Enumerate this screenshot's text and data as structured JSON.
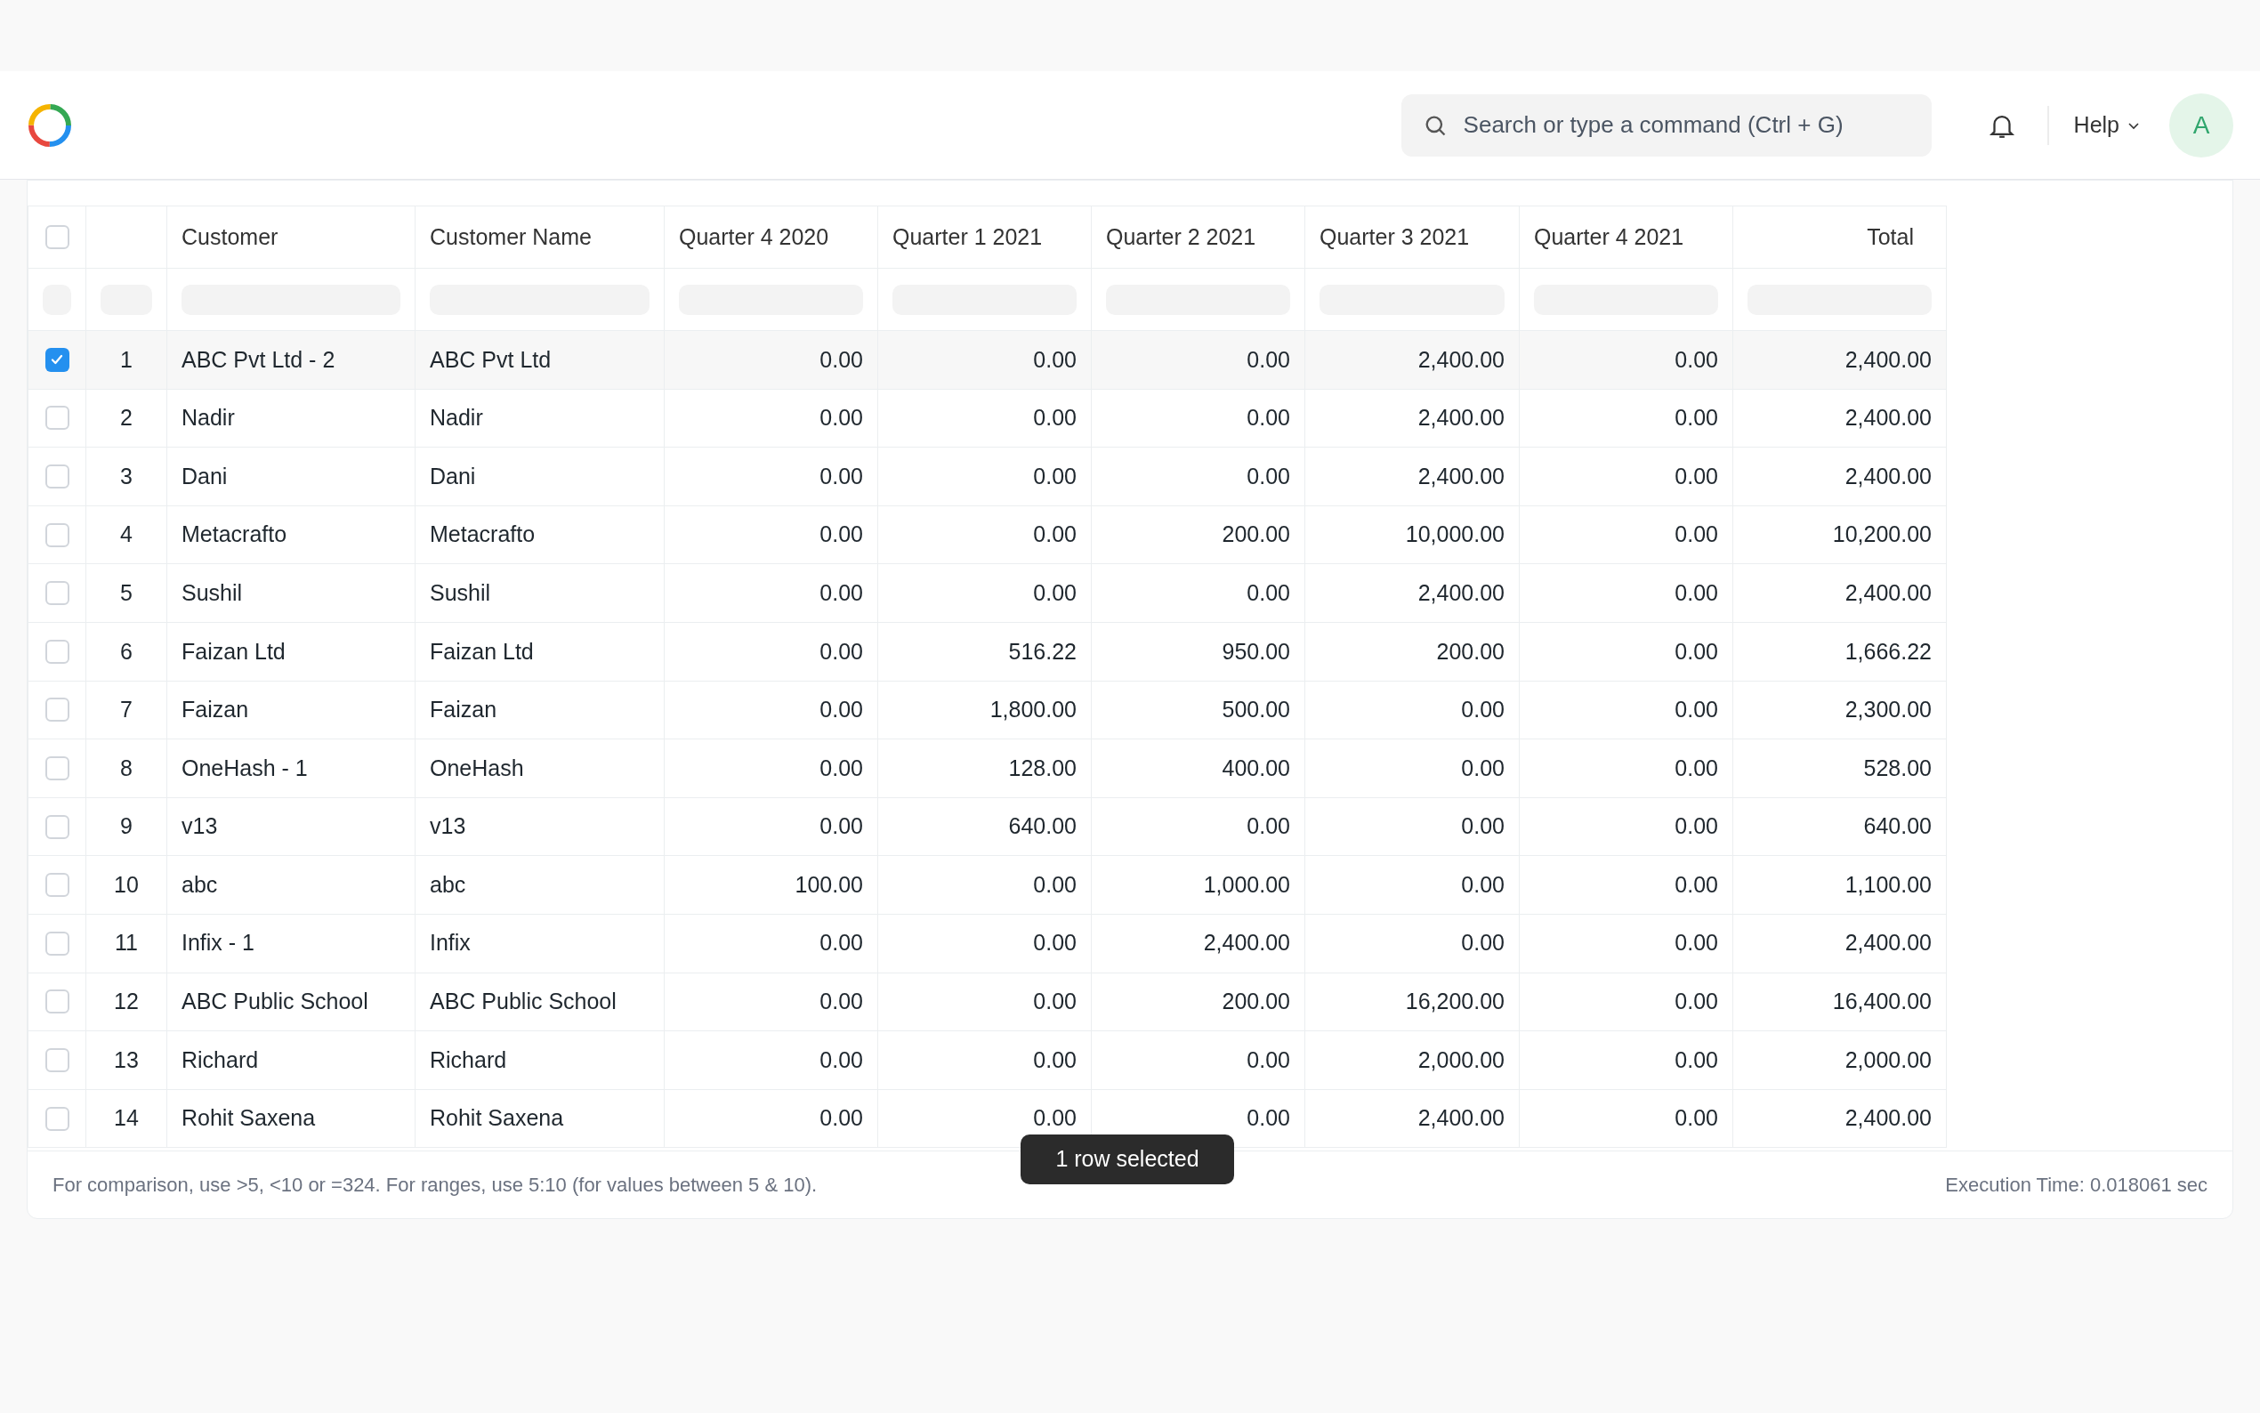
{
  "navbar": {
    "search": {
      "placeholder": "Search or type a command (Ctrl + G)"
    },
    "help": "Help",
    "avatar": "A"
  },
  "table": {
    "select_all": {
      "checked": false
    },
    "columns": [
      "Customer",
      "Customer Name",
      "Quarter 4 2020",
      "Quarter 1 2021",
      "Quarter 2 2021",
      "Quarter 3 2021",
      "Quarter 4 2021",
      "Total"
    ],
    "rows": [
      {
        "selected": true,
        "index": "1",
        "cells": [
          "ABC Pvt Ltd - 2",
          "ABC Pvt Ltd",
          "0.00",
          "0.00",
          "0.00",
          "2,400.00",
          "0.00",
          "2,400.00"
        ]
      },
      {
        "selected": false,
        "index": "2",
        "cells": [
          "Nadir",
          "Nadir",
          "0.00",
          "0.00",
          "0.00",
          "2,400.00",
          "0.00",
          "2,400.00"
        ]
      },
      {
        "selected": false,
        "index": "3",
        "cells": [
          "Dani",
          "Dani",
          "0.00",
          "0.00",
          "0.00",
          "2,400.00",
          "0.00",
          "2,400.00"
        ]
      },
      {
        "selected": false,
        "index": "4",
        "cells": [
          "Metacrafto",
          "Metacrafto",
          "0.00",
          "0.00",
          "200.00",
          "10,000.00",
          "0.00",
          "10,200.00"
        ]
      },
      {
        "selected": false,
        "index": "5",
        "cells": [
          "Sushil",
          "Sushil",
          "0.00",
          "0.00",
          "0.00",
          "2,400.00",
          "0.00",
          "2,400.00"
        ]
      },
      {
        "selected": false,
        "index": "6",
        "cells": [
          "Faizan Ltd",
          "Faizan Ltd",
          "0.00",
          "516.22",
          "950.00",
          "200.00",
          "0.00",
          "1,666.22"
        ]
      },
      {
        "selected": false,
        "index": "7",
        "cells": [
          "Faizan",
          "Faizan",
          "0.00",
          "1,800.00",
          "500.00",
          "0.00",
          "0.00",
          "2,300.00"
        ]
      },
      {
        "selected": false,
        "index": "8",
        "cells": [
          "OneHash - 1",
          "OneHash",
          "0.00",
          "128.00",
          "400.00",
          "0.00",
          "0.00",
          "528.00"
        ]
      },
      {
        "selected": false,
        "index": "9",
        "cells": [
          "v13",
          "v13",
          "0.00",
          "640.00",
          "0.00",
          "0.00",
          "0.00",
          "640.00"
        ]
      },
      {
        "selected": false,
        "index": "10",
        "cells": [
          "abc",
          "abc",
          "100.00",
          "0.00",
          "1,000.00",
          "0.00",
          "0.00",
          "1,100.00"
        ]
      },
      {
        "selected": false,
        "index": "11",
        "cells": [
          "Infix - 1",
          "Infix",
          "0.00",
          "0.00",
          "2,400.00",
          "0.00",
          "0.00",
          "2,400.00"
        ]
      },
      {
        "selected": false,
        "index": "12",
        "cells": [
          "ABC Public School",
          "ABC Public School",
          "0.00",
          "0.00",
          "200.00",
          "16,200.00",
          "0.00",
          "16,400.00"
        ]
      },
      {
        "selected": false,
        "index": "13",
        "cells": [
          "Richard",
          "Richard",
          "0.00",
          "0.00",
          "0.00",
          "2,000.00",
          "0.00",
          "2,000.00"
        ]
      },
      {
        "selected": false,
        "index": "14",
        "cells": [
          "Rohit Saxena",
          "Rohit Saxena",
          "0.00",
          "0.00",
          "0.00",
          "2,400.00",
          "0.00",
          "2,400.00"
        ]
      }
    ]
  },
  "toast": "1 row selected",
  "footer": {
    "hint": "For comparison, use >5, <10 or =324. For ranges, use 5:10 (for values between 5 & 10).",
    "execution_time": "Execution Time: 0.018061 sec"
  }
}
